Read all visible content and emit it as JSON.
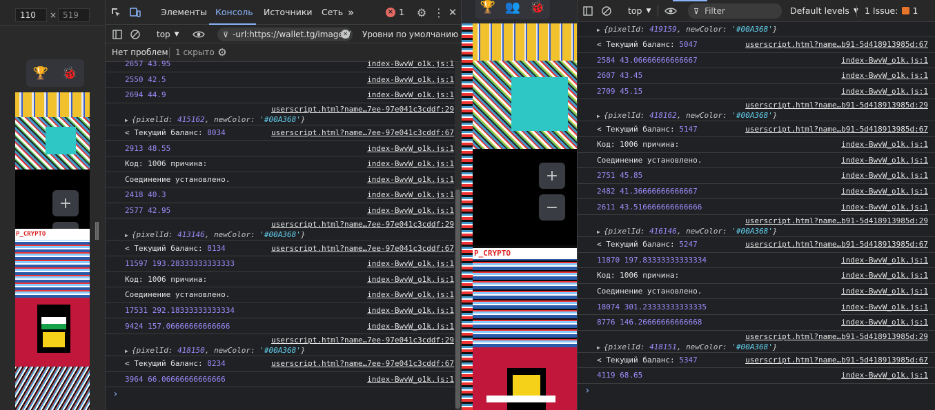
{
  "left_viewport": {
    "width_value": "110",
    "times": "×",
    "height_value": "519"
  },
  "left_devtools": {
    "tabs": [
      "Элементы",
      "Консоль",
      "Источники",
      "Сеть"
    ],
    "active_tab": "Консоль",
    "error_count": "1",
    "context": "top",
    "filter_value": "-url:https://wallet.tg/images/",
    "levels": "Уровни по умолчанию",
    "issues_text": "Нет проблем",
    "hidden_text": "1 скрыто",
    "rows": [
      {
        "type": "log",
        "a": "2657",
        "b": "43.95",
        "src": "index-BwvW_o1k.js:1"
      },
      {
        "type": "log",
        "a": "2550",
        "b": "42.5",
        "src": "index-BwvW_o1k.js:1"
      },
      {
        "type": "log",
        "a": "2694",
        "b": "44.9",
        "src": "index-BwvW_o1k.js:1"
      },
      {
        "type": "obj",
        "pixelId": "415162",
        "newColor": "'#00A368'",
        "src": "userscript.html?name…7ee-97e041c3cddf:29"
      },
      {
        "type": "bal",
        "label": "Текущий баланс:",
        "value": "8034",
        "src": "userscript.html?name…7ee-97e041c3cddf:67"
      },
      {
        "type": "log",
        "a": "2913",
        "b": "48.55",
        "src": "index-BwvW_o1k.js:1"
      },
      {
        "type": "text",
        "text": "Код: 1006 причина:",
        "src": "index-BwvW_o1k.js:1"
      },
      {
        "type": "text",
        "text": "Соединение установлено.",
        "src": "index-BwvW_o1k.js:1"
      },
      {
        "type": "log",
        "a": "2418",
        "b": "40.3",
        "src": "index-BwvW_o1k.js:1"
      },
      {
        "type": "log",
        "a": "2577",
        "b": "42.95",
        "src": "index-BwvW_o1k.js:1"
      },
      {
        "type": "obj",
        "pixelId": "413146",
        "newColor": "'#00A368'",
        "src": "userscript.html?name…7ee-97e041c3cddf:29"
      },
      {
        "type": "bal",
        "label": "Текущий баланс:",
        "value": "8134",
        "src": "userscript.html?name…7ee-97e041c3cddf:67"
      },
      {
        "type": "log",
        "a": "11597",
        "b": "193.28333333333333",
        "src": "index-BwvW_o1k.js:1"
      },
      {
        "type": "text",
        "text": "Код: 1006 причина:",
        "src": "index-BwvW_o1k.js:1"
      },
      {
        "type": "text",
        "text": "Соединение установлено.",
        "src": "index-BwvW_o1k.js:1"
      },
      {
        "type": "log",
        "a": "17531",
        "b": "292.18333333333334",
        "src": "index-BwvW_o1k.js:1"
      },
      {
        "type": "log",
        "a": "9424",
        "b": "157.06666666666666",
        "src": "index-BwvW_o1k.js:1"
      },
      {
        "type": "obj",
        "pixelId": "418150",
        "newColor": "'#00A368'",
        "src": "userscript.html?name…7ee-97e041c3cddf:29"
      },
      {
        "type": "bal",
        "label": "Текущий баланс:",
        "value": "8234",
        "src": "userscript.html?name…7ee-97e041c3cddf:67"
      },
      {
        "type": "log",
        "a": "3964",
        "b": "66.06666666666666",
        "src": "index-BwvW_o1k.js:1"
      }
    ],
    "prompt": "›"
  },
  "right_devtools": {
    "context": "top",
    "filter_placeholder": "Filter",
    "levels": "Default levels",
    "issues_label": "1 Issue:",
    "issues_count": "1",
    "first_obj": {
      "pixelId": "419159",
      "newColor": "'#00A368'"
    },
    "rows": [
      {
        "type": "bal",
        "label": "Текущий баланс:",
        "value": "5047",
        "src": "userscript.html?name…b91-5d418913985d:67"
      },
      {
        "type": "log",
        "a": "2584",
        "b": "43.06666666666667",
        "src": "index-BwvW_o1k.js:1"
      },
      {
        "type": "log",
        "a": "2607",
        "b": "43.45",
        "src": "index-BwvW_o1k.js:1"
      },
      {
        "type": "log",
        "a": "2709",
        "b": "45.15",
        "src": "index-BwvW_o1k.js:1"
      },
      {
        "type": "obj",
        "pixelId": "418162",
        "newColor": "'#00A368'",
        "src": "userscript.html?name…b91-5d418913985d:29"
      },
      {
        "type": "bal",
        "label": "Текущий баланс:",
        "value": "5147",
        "src": "userscript.html?name…b91-5d418913985d:67"
      },
      {
        "type": "text",
        "text": "Код: 1006 причина:",
        "src": "index-BwvW_o1k.js:1"
      },
      {
        "type": "text",
        "text": "Соединение установлено.",
        "src": "index-BwvW_o1k.js:1"
      },
      {
        "type": "log",
        "a": "2751",
        "b": "45.85",
        "src": "index-BwvW_o1k.js:1"
      },
      {
        "type": "log",
        "a": "2482",
        "b": "41.36666666666667",
        "src": "index-BwvW_o1k.js:1"
      },
      {
        "type": "log",
        "a": "2611",
        "b": "43.516666666666666",
        "src": "index-BwvW_o1k.js:1"
      },
      {
        "type": "obj",
        "pixelId": "416146",
        "newColor": "'#00A368'",
        "src": "userscript.html?name…b91-5d418913985d:29"
      },
      {
        "type": "bal",
        "label": "Текущий баланс:",
        "value": "5247",
        "src": "userscript.html?name…b91-5d418913985d:67"
      },
      {
        "type": "log",
        "a": "11870",
        "b": "197.83333333333334",
        "src": "index-BwvW_o1k.js:1"
      },
      {
        "type": "text",
        "text": "Код: 1006 причина:",
        "src": "index-BwvW_o1k.js:1"
      },
      {
        "type": "text",
        "text": "Соединение установлено.",
        "src": "index-BwvW_o1k.js:1"
      },
      {
        "type": "log",
        "a": "18074",
        "b": "301.23333333333335",
        "src": "index-BwvW_o1k.js:1"
      },
      {
        "type": "log",
        "a": "8776",
        "b": "146.26666666666668",
        "src": "index-BwvW_o1k.js:1"
      },
      {
        "type": "obj",
        "pixelId": "418151",
        "newColor": "'#00A368'",
        "src": "userscript.html?name…b91-5d418913985d:29"
      },
      {
        "type": "bal",
        "label": "Текущий баланс:",
        "value": "5347",
        "src": "userscript.html?name…b91-5d418913985d:67"
      },
      {
        "type": "log",
        "a": "4119",
        "b": "68.65",
        "src": "index-BwvW_o1k.js:1"
      }
    ],
    "prompt": "›"
  },
  "page_preview": {
    "btn_plus": "+",
    "btn_minus": "−",
    "banner_text": "P_CRYPTO"
  },
  "colors": {
    "number": "#9d8cfc",
    "string": "#62d2f0",
    "accent": "#8ab4f8",
    "error": "#e46962"
  }
}
